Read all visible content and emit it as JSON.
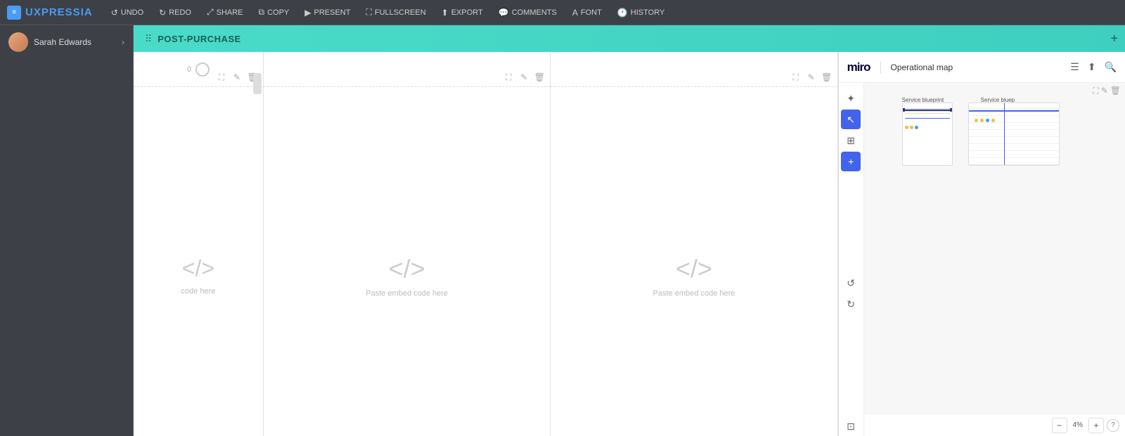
{
  "logo": {
    "icon": "U",
    "text": "UXPRESSIA"
  },
  "nav": {
    "items": [
      {
        "id": "undo",
        "label": "UNDO",
        "icon": "↺"
      },
      {
        "id": "redo",
        "label": "REDO",
        "icon": "↻"
      },
      {
        "id": "share",
        "label": "SHARE",
        "icon": "⤢"
      },
      {
        "id": "copy",
        "label": "COPY",
        "icon": "⧉"
      },
      {
        "id": "present",
        "label": "PRESENT",
        "icon": "▶"
      },
      {
        "id": "fullscreen",
        "label": "FULLSCREEN",
        "icon": "⛶"
      },
      {
        "id": "export",
        "label": "EXPORT",
        "icon": "⬆"
      },
      {
        "id": "comments",
        "label": "COMMENTS",
        "icon": "💬"
      },
      {
        "id": "font",
        "label": "FONT",
        "icon": "A"
      },
      {
        "id": "history",
        "label": "HISTORY",
        "icon": "🕐"
      }
    ]
  },
  "sidebar": {
    "user": {
      "name": "Sarah Edwards"
    }
  },
  "phase": {
    "title": "POST-PURCHASE",
    "add_label": "+"
  },
  "columns": [
    {
      "id": "col1",
      "has_embed": false,
      "partial_text": "code here",
      "show_num": true
    },
    {
      "id": "col2",
      "has_embed": true,
      "embed_text": "Paste embed code here"
    },
    {
      "id": "col3",
      "has_embed": true,
      "embed_text": "Paste embed code here"
    },
    {
      "id": "col4",
      "is_miro": true
    }
  ],
  "miro": {
    "logo": "miro",
    "title": "Operational map",
    "zoom": "4%",
    "blueprint_label1": "Service blueprint",
    "blueprint_label2": "Service bluep",
    "tools": [
      {
        "id": "sparkle",
        "icon": "✦",
        "active": false
      },
      {
        "id": "cursor",
        "icon": "↖",
        "active": true
      },
      {
        "id": "grid",
        "icon": "⊞",
        "active": false
      },
      {
        "id": "plus",
        "icon": "+",
        "active": false
      },
      {
        "id": "undo-t",
        "icon": "↺",
        "active": false
      },
      {
        "id": "redo-t",
        "icon": "↻",
        "active": false
      },
      {
        "id": "frame",
        "icon": "⊡",
        "active": false
      }
    ]
  }
}
